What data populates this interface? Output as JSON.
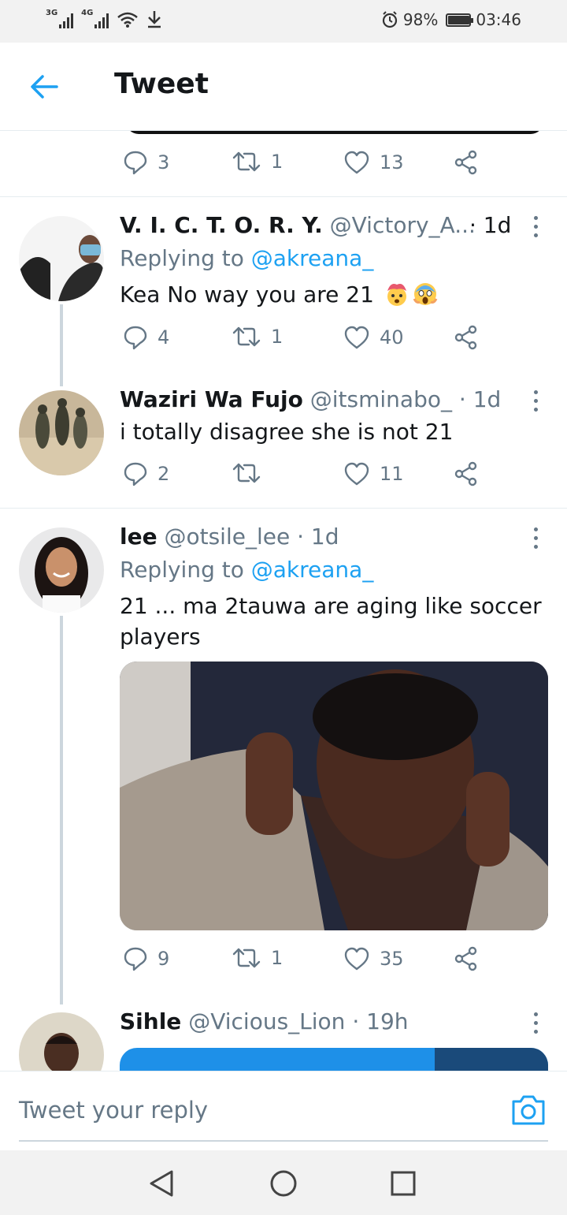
{
  "status_bar": {
    "network1": "3G",
    "network2": "4G",
    "battery_percent": "98%",
    "battery_level": 0.98,
    "time": "03:46"
  },
  "header": {
    "title": "Tweet",
    "back_icon": "arrow-left-icon"
  },
  "accent_color": "#1da1f2",
  "main_tweet_actions": {
    "replies": "3",
    "retweets": "1",
    "likes": "13"
  },
  "replies": [
    {
      "name": "V. I. C. T. O. R. Y.",
      "handle": "@Victory_A...",
      "time": "· 1d",
      "replying_prefix": "Replying to",
      "replying_to": "@akreana_",
      "text": "Kea No way you are 21",
      "emojis": [
        "exploding-head-emoji",
        "screaming-face-emoji"
      ],
      "replies": "4",
      "retweets": "1",
      "likes": "40"
    },
    {
      "name": "Waziri Wa Fujo",
      "handle": "@itsminabo_",
      "time": "· 1d",
      "text": "i totally disagree she is not 21",
      "replies": "2",
      "retweets": "",
      "likes": "11"
    },
    {
      "name": "lee",
      "handle": "@otsile_lee",
      "time": "· 1d",
      "replying_prefix": "Replying to",
      "replying_to": "@akreana_",
      "text": "21 ... ma 2tauwa are aging like soccer players",
      "has_image": true,
      "replies": "9",
      "retweets": "1",
      "likes": "35"
    },
    {
      "name": "Sihle",
      "handle": "@Vicious_Lion",
      "time": "· 19h"
    }
  ],
  "compose": {
    "placeholder": "Tweet your reply",
    "camera_icon": "camera-icon"
  },
  "nav": {
    "back_icon": "triangle-back-icon",
    "home_icon": "circle-home-icon",
    "recents_icon": "square-recents-icon"
  }
}
